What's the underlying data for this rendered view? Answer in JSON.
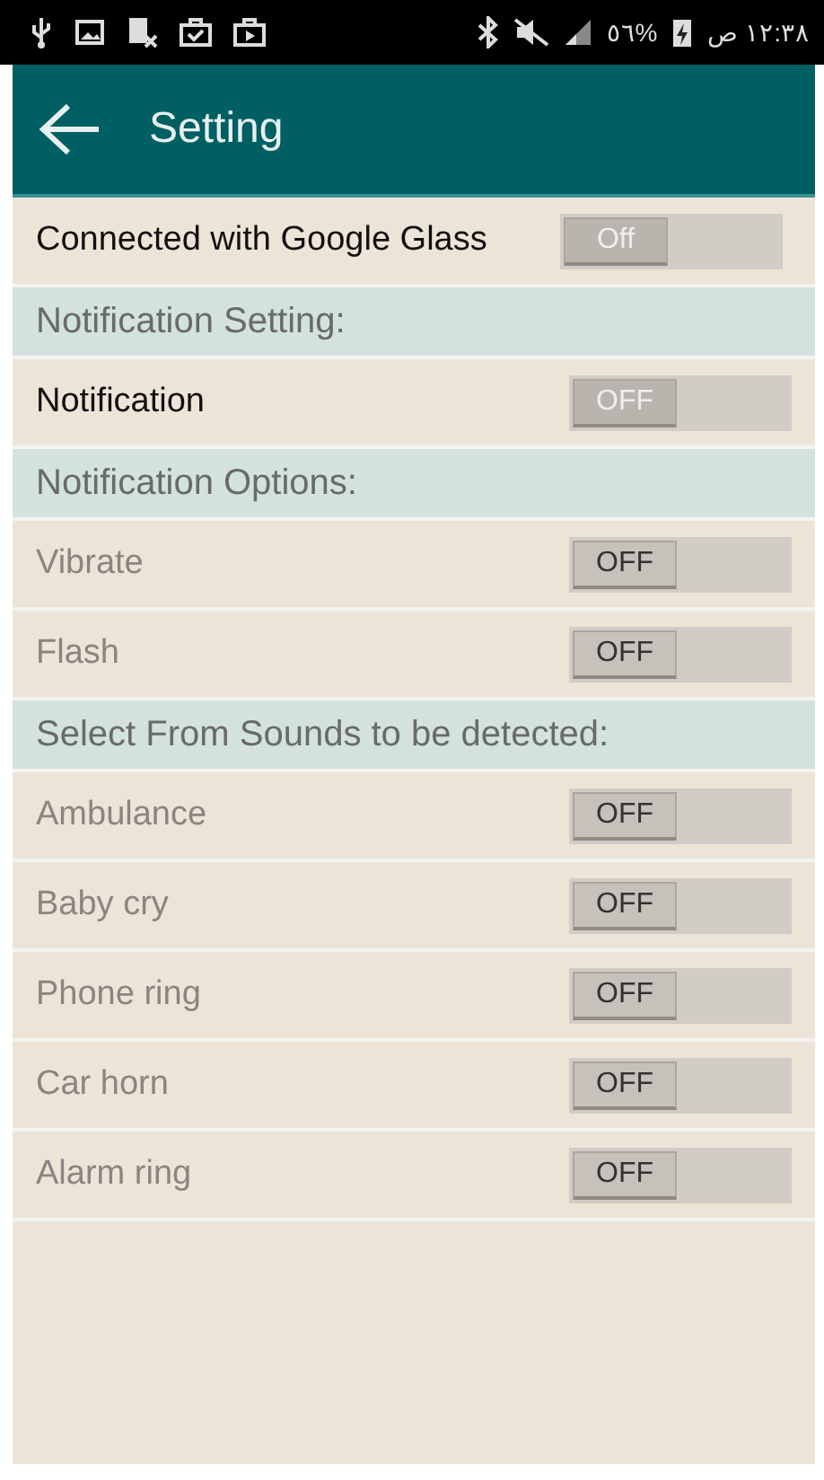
{
  "status_bar": {
    "battery_text": "٥٦%",
    "time": "١٢:٣٨ ص"
  },
  "app_bar": {
    "title": "Setting"
  },
  "rows": [
    {
      "kind": "toggle",
      "label": "Connected with Google Glass",
      "toggle_text": "Off",
      "on": false,
      "disabled": false
    },
    {
      "kind": "header",
      "label": "Notification Setting:"
    },
    {
      "kind": "toggle",
      "label": "Notification",
      "toggle_text": "OFF",
      "on": false,
      "disabled": false
    },
    {
      "kind": "header",
      "label": "Notification Options:"
    },
    {
      "kind": "toggle",
      "label": "Vibrate",
      "toggle_text": "OFF",
      "on": false,
      "disabled": true
    },
    {
      "kind": "toggle",
      "label": "Flash",
      "toggle_text": "OFF",
      "on": false,
      "disabled": true
    },
    {
      "kind": "header",
      "label": "Select From Sounds to be detected:"
    },
    {
      "kind": "toggle",
      "label": "Ambulance",
      "toggle_text": "OFF",
      "on": false,
      "disabled": true
    },
    {
      "kind": "toggle",
      "label": "Baby cry",
      "toggle_text": "OFF",
      "on": false,
      "disabled": true
    },
    {
      "kind": "toggle",
      "label": "Phone ring",
      "toggle_text": "OFF",
      "on": false,
      "disabled": true
    },
    {
      "kind": "toggle",
      "label": "Car horn",
      "toggle_text": "OFF",
      "on": false,
      "disabled": true
    },
    {
      "kind": "toggle",
      "label": "Alarm ring",
      "toggle_text": "OFF",
      "on": false,
      "disabled": true
    }
  ]
}
